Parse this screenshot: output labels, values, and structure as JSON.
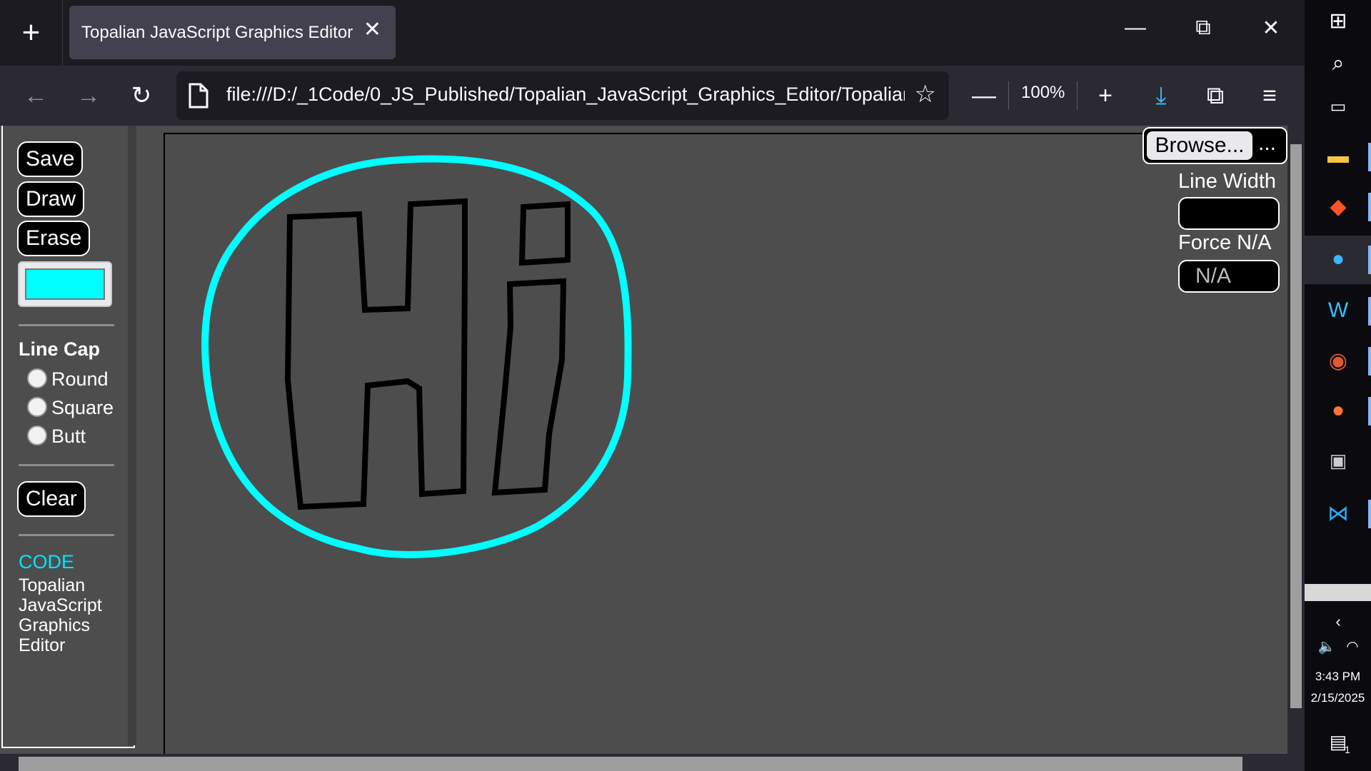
{
  "tab": {
    "title": "Topalian JavaScript Graphics Editor"
  },
  "window": {
    "new_tab": "+",
    "close_tab": "✕",
    "minimize": "—",
    "restore": "⧉",
    "close": "✕"
  },
  "nav": {
    "url": "file:///D:/_1Code/0_JS_Published/Topalian_JavaScript_Graphics_Editor/Topalian_",
    "zoom": "100%"
  },
  "sidebar": {
    "save": "Save",
    "draw": "Draw",
    "erase": "Erase",
    "color": "#00ffff",
    "line_cap_title": "Line Cap",
    "line_caps": [
      "Round",
      "Square",
      "Butt"
    ],
    "clear": "Clear",
    "code_link": "CODE",
    "app_title_lines": [
      "Topalian",
      "JavaScript",
      "Graphics",
      "Editor"
    ]
  },
  "panel": {
    "browse": "Browse...",
    "file_ellipsis": "...",
    "line_width_label": "Line Width",
    "line_width_value": "",
    "force_label": "Force N/A",
    "force_placeholder": "N/A"
  },
  "canvas_drawing": {
    "text": "Hi",
    "stroke_color": "#000000",
    "circle_color": "#00ffff"
  },
  "taskbar": {
    "time": "3:43 PM",
    "date": "2/15/2025",
    "notification_count": "1"
  }
}
